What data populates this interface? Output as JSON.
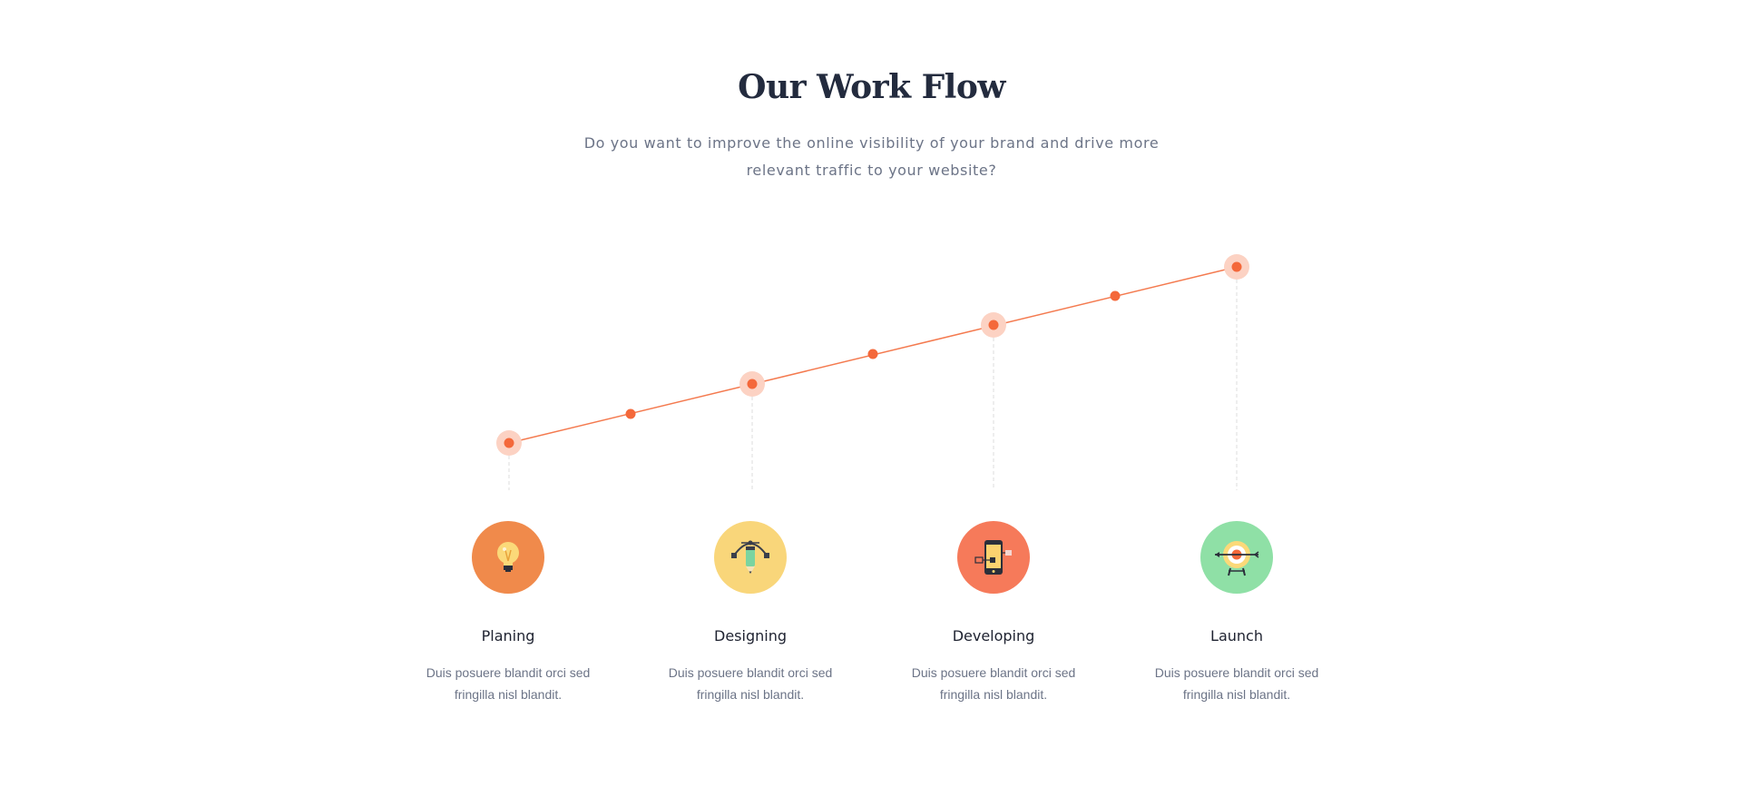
{
  "section": {
    "title": "Our Work Flow",
    "subtitle": "Do you want to improve the online visibility of your brand and drive more relevant traffic to your website?"
  },
  "colors": {
    "line": "#f47a4f",
    "dot": "#f4683a",
    "halo": "#fcd2c3",
    "guide": "#dddddd"
  },
  "steps": [
    {
      "title": "Planing",
      "description": "Duis posuere blandit orci sed fringilla nisl blandit.",
      "icon": "lightbulb-icon",
      "color": "#f08a4b"
    },
    {
      "title": "Designing",
      "description": "Duis posuere blandit orci sed fringilla nisl blandit.",
      "icon": "pen-tool-icon",
      "color": "#f9d67a"
    },
    {
      "title": "Developing",
      "description": "Duis posuere blandit orci sed fringilla nisl blandit.",
      "icon": "mobile-device-icon",
      "color": "#f67a5a"
    },
    {
      "title": "Launch",
      "description": "Duis posuere blandit orci sed fringilla nisl blandit.",
      "icon": "target-icon",
      "color": "#8fe0a6"
    }
  ]
}
